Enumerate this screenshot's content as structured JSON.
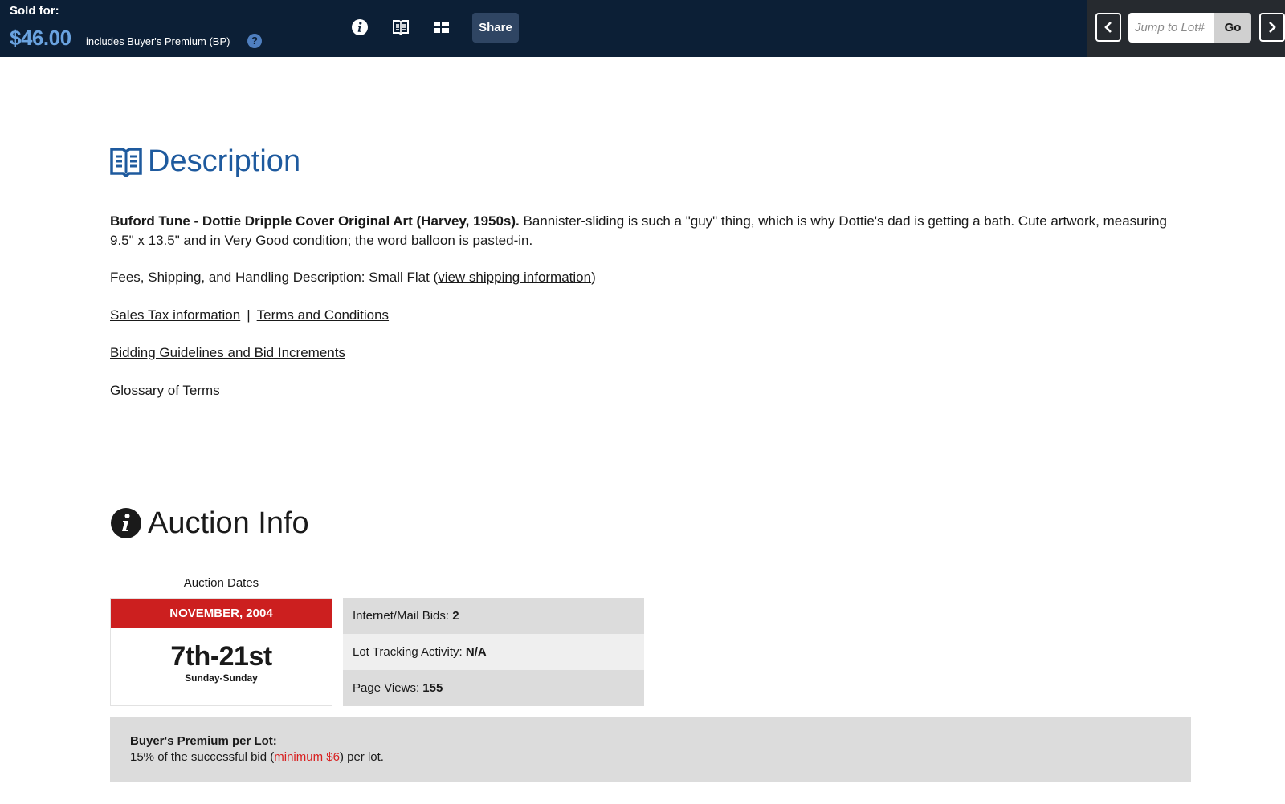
{
  "topbar": {
    "sold_label": "Sold for:",
    "sold_price": "$46.00",
    "bp_note": "includes Buyer's Premium (BP)",
    "help_glyph": "?",
    "share_label": "Share",
    "jump_placeholder": "Jump to Lot#",
    "go_label": "Go",
    "icons": [
      "info-icon",
      "book-icon",
      "grid-icon",
      "chevron-left-icon",
      "chevron-right-icon",
      "help-icon"
    ],
    "colors": {
      "bar": "#0c1f36",
      "price": "#6aa3e0",
      "right_panel": "#262a2f"
    }
  },
  "description": {
    "title": "Description",
    "lead_bold": "Buford Tune - Dottie Dripple Cover Original Art (Harvey, 1950s).",
    "body": " Bannister-sliding is such a \"guy\" thing, which is why Dottie's dad is getting a bath. Cute artwork, measuring 9.5\" x 13.5\" and in Very Good condition; the word balloon is pasted-in.",
    "fees_prefix": "Fees, Shipping, and Handling Description: Small Flat (",
    "fees_link": "view shipping information",
    "fees_suffix": ")",
    "sales_tax_link": "Sales Tax information",
    "separator": "|",
    "terms_link": "Terms and Conditions",
    "bidding_link": "Bidding Guidelines and Bid Increments",
    "glossary_link": "Glossary of Terms",
    "title_color": "#1e5a9e"
  },
  "auction_info": {
    "title": "Auction Info",
    "dates_label": "Auction Dates",
    "month": "NOVEMBER, 2004",
    "days": "7th-21st",
    "weekdays": "Sunday-Sunday",
    "stats": [
      {
        "label": "Internet/Mail Bids: ",
        "value": "2"
      },
      {
        "label": "Lot Tracking Activity: ",
        "value": "N/A"
      },
      {
        "label": "Page Views: ",
        "value": "155"
      }
    ],
    "bp_title": "Buyer's Premium per Lot:",
    "bp_prefix": "15% of the successful bid (",
    "bp_min": "minimum $6",
    "bp_suffix": ") per lot.",
    "accent_red": "#cc1f1f"
  }
}
